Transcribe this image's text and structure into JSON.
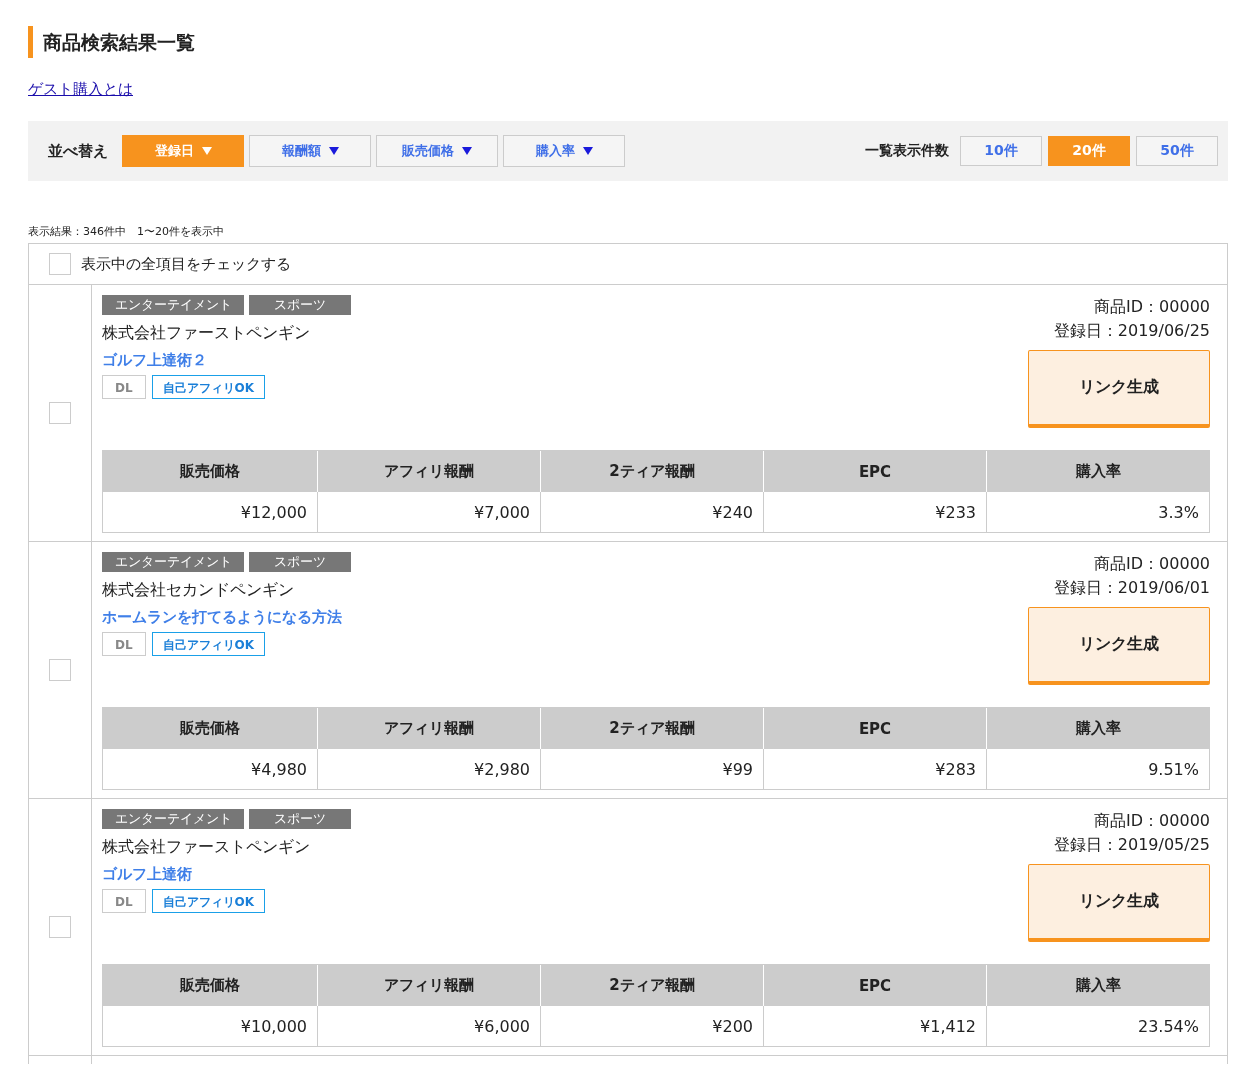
{
  "page_title": "商品検索結果一覧",
  "guest_link": "ゲスト購入とは",
  "sort_bar": {
    "label": "並べ替え",
    "options": [
      {
        "label": "登録日",
        "selected": true
      },
      {
        "label": "報酬額",
        "selected": false
      },
      {
        "label": "販売価格",
        "selected": false
      },
      {
        "label": "購入率",
        "selected": false
      }
    ],
    "count_label": "一覧表示件数",
    "counts": [
      {
        "label": "10件",
        "selected": false
      },
      {
        "label": "20件",
        "selected": true
      },
      {
        "label": "50件",
        "selected": false
      }
    ]
  },
  "result_summary": "表示結果：346件中　1〜20件を表示中",
  "check_all": {
    "label": "表示中の全項目をチェックする",
    "checked": false
  },
  "products": [
    {
      "checked": false,
      "tags": [
        "エンターテイメント",
        "スポーツ"
      ],
      "company": "株式会社ファーストペンギン",
      "title": "ゴルフ上達術２",
      "badges": [
        {
          "kind": "plain",
          "label": "DL"
        },
        {
          "kind": "outline",
          "label": "自己アフィリOK"
        }
      ],
      "product_id": "商品ID：00000",
      "registered": "登録日：2019/06/25",
      "action": "リンク生成",
      "columns": [
        "販売価格",
        "アフィリ報酬",
        "2ティア報酬",
        "EPC",
        "購入率"
      ],
      "stats": [
        "¥12,000",
        "¥7,000",
        "¥240",
        "¥233",
        "3.3%"
      ]
    },
    {
      "checked": false,
      "tags": [
        "エンターテイメント",
        "スポーツ"
      ],
      "company": "株式会社セカンドペンギン",
      "title": "ホームランを打てるようになる方法",
      "badges": [
        {
          "kind": "plain",
          "label": "DL"
        },
        {
          "kind": "outline",
          "label": "自己アフィリOK"
        }
      ],
      "product_id": "商品ID：00000",
      "registered": "登録日：2019/06/01",
      "action": "リンク生成",
      "columns": [
        "販売価格",
        "アフィリ報酬",
        "2ティア報酬",
        "EPC",
        "購入率"
      ],
      "stats": [
        "¥4,980",
        "¥2,980",
        "¥99",
        "¥283",
        "9.51%"
      ]
    },
    {
      "checked": false,
      "tags": [
        "エンターテイメント",
        "スポーツ"
      ],
      "company": "株式会社ファーストペンギン",
      "title": "ゴルフ上達術",
      "badges": [
        {
          "kind": "plain",
          "label": "DL"
        },
        {
          "kind": "outline",
          "label": "自己アフィリOK"
        }
      ],
      "product_id": "商品ID：00000",
      "registered": "登録日：2019/05/25",
      "action": "リンク生成",
      "columns": [
        "販売価格",
        "アフィリ報酬",
        "2ティア報酬",
        "EPC",
        "購入率"
      ],
      "stats": [
        "¥10,000",
        "¥6,000",
        "¥200",
        "¥1,412",
        "23.54%"
      ]
    }
  ]
}
